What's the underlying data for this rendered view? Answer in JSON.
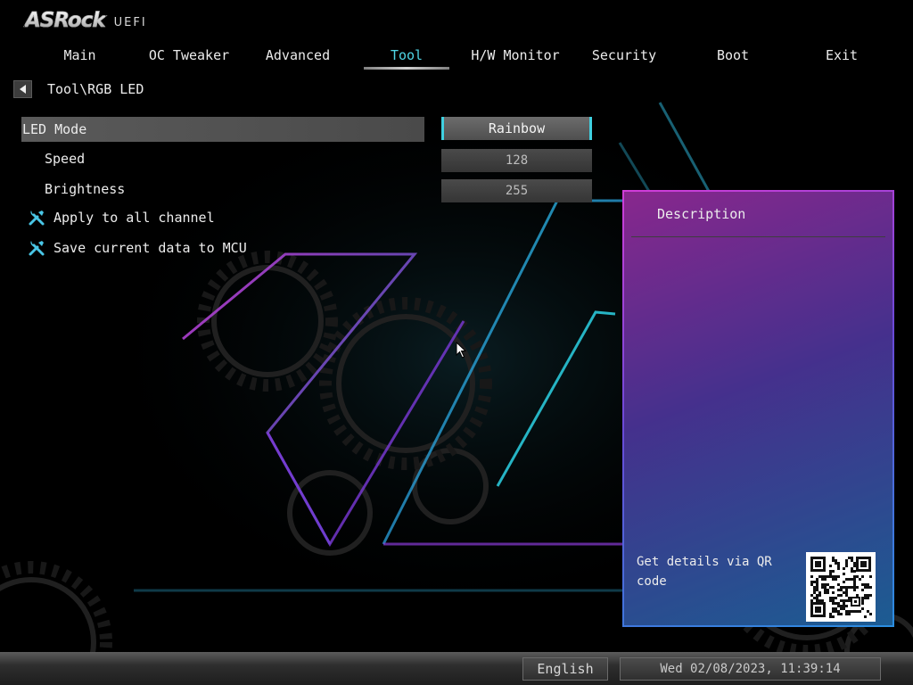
{
  "header": {
    "brand": "ASRock",
    "product": "UEFI"
  },
  "tabs": [
    {
      "label": "Main",
      "active": false
    },
    {
      "label": "OC Tweaker",
      "active": false
    },
    {
      "label": "Advanced",
      "active": false
    },
    {
      "label": "Tool",
      "active": true
    },
    {
      "label": "H/W Monitor",
      "active": false
    },
    {
      "label": "Security",
      "active": false
    },
    {
      "label": "Boot",
      "active": false
    },
    {
      "label": "Exit",
      "active": false
    }
  ],
  "breadcrumb": "Tool\\RGB LED",
  "settings": {
    "led_mode": {
      "label": "LED Mode",
      "value": "Rainbow"
    },
    "speed": {
      "label": "Speed",
      "value": "128"
    },
    "brightness": {
      "label": "Brightness",
      "value": "255"
    },
    "apply_all": {
      "label": "Apply to all channel",
      "icon": "tools-icon"
    },
    "save_mcu": {
      "label": "Save current data to MCU",
      "icon": "tools-icon"
    }
  },
  "description": {
    "title": "Description",
    "qr_text": "Get details via QR code",
    "qr_icon": "qr-code-icon"
  },
  "footer": {
    "language": "English",
    "datetime": "Wed 02/08/2023, 11:39:14"
  },
  "colors": {
    "accent": "#4fd6e6",
    "panel_border_top": "#d23cd8",
    "panel_border_bottom": "#2a8ee0"
  }
}
